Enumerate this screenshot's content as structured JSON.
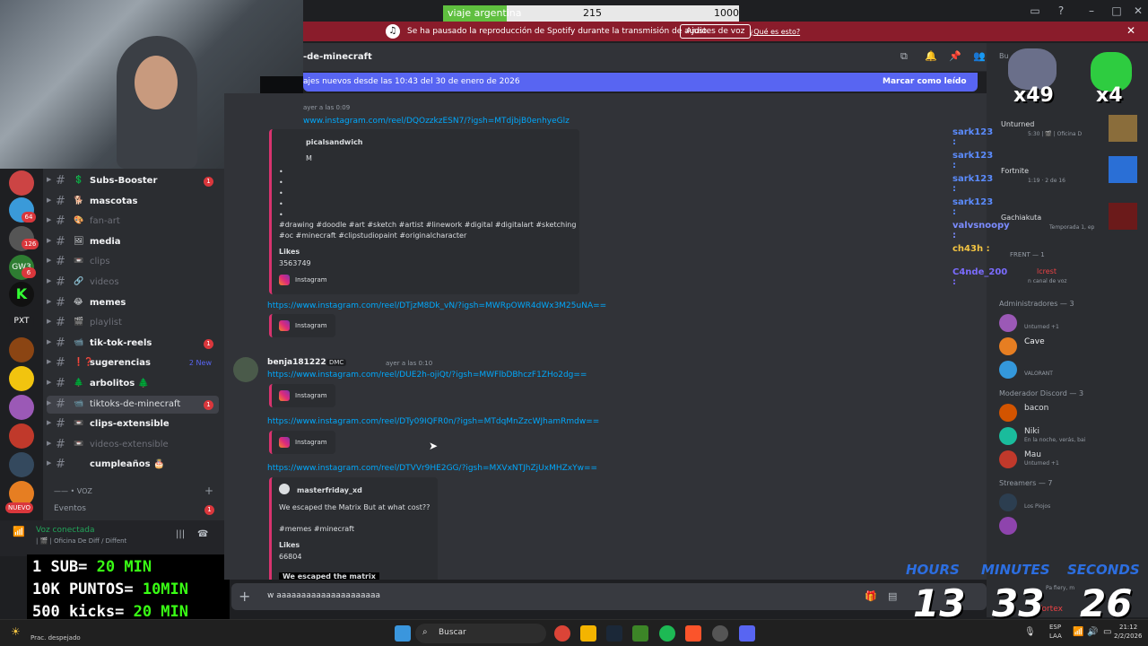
{
  "poll": {
    "label": "viaje argentina",
    "count": "215",
    "goal": "1000",
    "progress": 0.215
  },
  "spotify_banner": {
    "icon": "spotify-icon",
    "message": "Se ha pausado la reproducción de Spotify durante la transmisión de audio.",
    "button": "Ajustes de voz",
    "link": "¿Qué es esto?"
  },
  "channels": [
    {
      "emoji": "💲",
      "name": "Subs-Booster",
      "badge": "1",
      "state": "unread"
    },
    {
      "emoji": "🐕",
      "name": "mascotas",
      "badge": "",
      "state": "unread"
    },
    {
      "emoji": "🎨",
      "name": "fan-art",
      "badge": "",
      "state": "muted"
    },
    {
      "emoji": "🖼",
      "name": "media",
      "badge": "",
      "state": "unread"
    },
    {
      "emoji": "📼",
      "name": "clips",
      "badge": "",
      "state": "muted"
    },
    {
      "emoji": "🔗",
      "name": "videos",
      "badge": "",
      "state": "muted"
    },
    {
      "emoji": "😂",
      "name": "memes",
      "badge": "",
      "state": "unread"
    },
    {
      "emoji": "🎬",
      "name": "playlist",
      "badge": "",
      "state": "muted"
    },
    {
      "emoji": "📹",
      "name": "tik-tok-reels",
      "badge": "1",
      "state": "unread"
    },
    {
      "emoji": "❗❓",
      "name": "sugerencias",
      "badge": "",
      "state": "unread",
      "new": "2 New"
    },
    {
      "emoji": "🌲",
      "name": "arbolitos 🌲",
      "badge": "",
      "state": "unread"
    },
    {
      "emoji": "📹",
      "name": "tiktoks-de-minecraft",
      "badge": "1",
      "state": "active"
    },
    {
      "emoji": "📼",
      "name": "clips-extensible",
      "badge": "",
      "state": "unread"
    },
    {
      "emoji": "📼",
      "name": "videos-extensible",
      "badge": "",
      "state": "muted"
    },
    {
      "emoji": "",
      "name": "cumpleaños 🎂",
      "badge": "",
      "state": "unread"
    }
  ],
  "voice_category": "—— • VOZ",
  "events": {
    "label": "Eventos",
    "badge": "1"
  },
  "voice_status": {
    "title": "Voz conectada",
    "subtitle": "| 🎬 | Oficina De Diff / Diffent"
  },
  "server_badges": [
    "64",
    "126",
    "6"
  ],
  "server_labels": {
    "pxt": "PXT",
    "gw": "GW3",
    "nuevo": "NUEVO"
  },
  "channel_header": {
    "name": "tiktoks-de-minecraft",
    "visible_text": "-de-minecraft",
    "search_placeholder": "Bu"
  },
  "new_messages_banner": {
    "text": "ajes nuevos desde las 10:43 del 30 de enero de 2026",
    "action": "Marcar como leído"
  },
  "messages": {
    "m1_time": "ayer a las 0:09",
    "link1": "www.instagram.com/reel/DQOzzkzESN7/?igsh=MTdjbjB0enhyeGlz",
    "embed1_author": "picalsandwich",
    "embed1_sub": "M",
    "embed1_tags": "#drawing #doodle #art #sketch #artist #linework #digital #digitalart #sketching",
    "embed1_tags2": "#oc #minecraft #clipstudiopaint #originalcharacter",
    "embed1_likes_label": "Likes",
    "embed1_likes": "3563749",
    "instagram": "Instagram",
    "link2": "https://www.instagram.com/reel/DTjzM8Dk_vN/?igsh=MWRpOWR4dWx3M25uNA==",
    "m2_author": "benja181222",
    "m2_tag": "DMC",
    "m2_time": "ayer a las 0:10",
    "link3": "https://www.instagram.com/reel/DUE2h-ojiQt/?igsh=MWFlbDBhczF1ZHo2dg==",
    "link4": "https://www.instagram.com/reel/DTy09IQFR0n/?igsh=MTdqMnZzcWJhamRmdw==",
    "link5": "https://www.instagram.com/reel/DTVVr9HE2GG/?igsh=MXVxNTJhZjUxMHZxYw==",
    "embed5_author": "masterfriday_xd",
    "embed5_title": "We escaped the Matrix But at what cost??",
    "embed5_tags": "#memes #minecraft",
    "embed5_likes_label": "Likes",
    "embed5_likes": "66804",
    "embed5_cut": "We escaped the matrix"
  },
  "message_input": "w aaaaaaaaaaaaaaaaaaaaa",
  "members": {
    "activity": [
      {
        "name": "Unturned",
        "sub": "5:30  | 🎬 | Oficina D"
      },
      {
        "name": "Fortnite",
        "sub": "1:19  · 2 de 16"
      },
      {
        "name": "Gachiakuta",
        "sub": "Temporada 1, ep"
      },
      {
        "name": "FRENT — 1",
        "sub": ""
      },
      {
        "name": "lcrest",
        "sub": "n canal de voz"
      }
    ],
    "groups": [
      {
        "title": "Administradores — 3",
        "items": [
          {
            "name": "",
            "sub": "Unturned +1",
            "color": "#c9cdfb"
          },
          {
            "name": "Cave",
            "sub": "",
            "color": "#f2f3f5"
          },
          {
            "name": "",
            "sub": "VALORANT",
            "color": "#c9cdfb"
          }
        ]
      },
      {
        "title": "Moderador Discord — 3",
        "items": [
          {
            "name": "bacon",
            "sub": "",
            "color": "#dbdee1"
          },
          {
            "name": "Niki",
            "sub": "En la noche, verás, bai",
            "color": "#dbdee1"
          },
          {
            "name": "Mau",
            "sub": "Unturned +1",
            "color": "#dbdee1"
          }
        ]
      },
      {
        "title": "Streamers — 7",
        "items": [
          {
            "name": "",
            "sub": "Los Piojos",
            "color": "#ed4245"
          },
          {
            "name": "",
            "sub": "",
            "color": "#ed4245"
          }
        ]
      }
    ],
    "pa_fiery": "Pa fiery, m",
    "vortex": "Vortex"
  },
  "kick_feed": [
    {
      "name": "sark123 :",
      "color": "#5b8cff"
    },
    {
      "name": "sark123 :",
      "color": "#5b8cff"
    },
    {
      "name": "sark123 :",
      "color": "#5b8cff"
    },
    {
      "name": "sark123 :",
      "color": "#5b8cff"
    },
    {
      "name": "valvsnoopy :",
      "color": "#7b8cff"
    },
    {
      "name": "ch43h :",
      "color": "#f4c542"
    },
    {
      "name": "C4nde_200 :",
      "color": "#7b6cff"
    }
  ],
  "emote_counts": {
    "left": "x49",
    "right": "x4"
  },
  "overlay_promo": [
    {
      "a": "1 SUB= ",
      "b": "20 MIN"
    },
    {
      "a": "10K PUNTOS= ",
      "b": "10MIN"
    },
    {
      "a": "500 kicks= ",
      "b": "20 MIN"
    }
  ],
  "timer": {
    "hours_label": "HOURS",
    "minutes_label": "MINUTES",
    "seconds_label": "SECONDS",
    "hours": "13",
    "minutes": "33",
    "seconds": "26"
  },
  "taskbar": {
    "weather": "Prac. despejado",
    "search": "Buscar",
    "lang1": "ESP",
    "lang2": "LAA",
    "time": "21:12",
    "date": "2/2/2026"
  }
}
